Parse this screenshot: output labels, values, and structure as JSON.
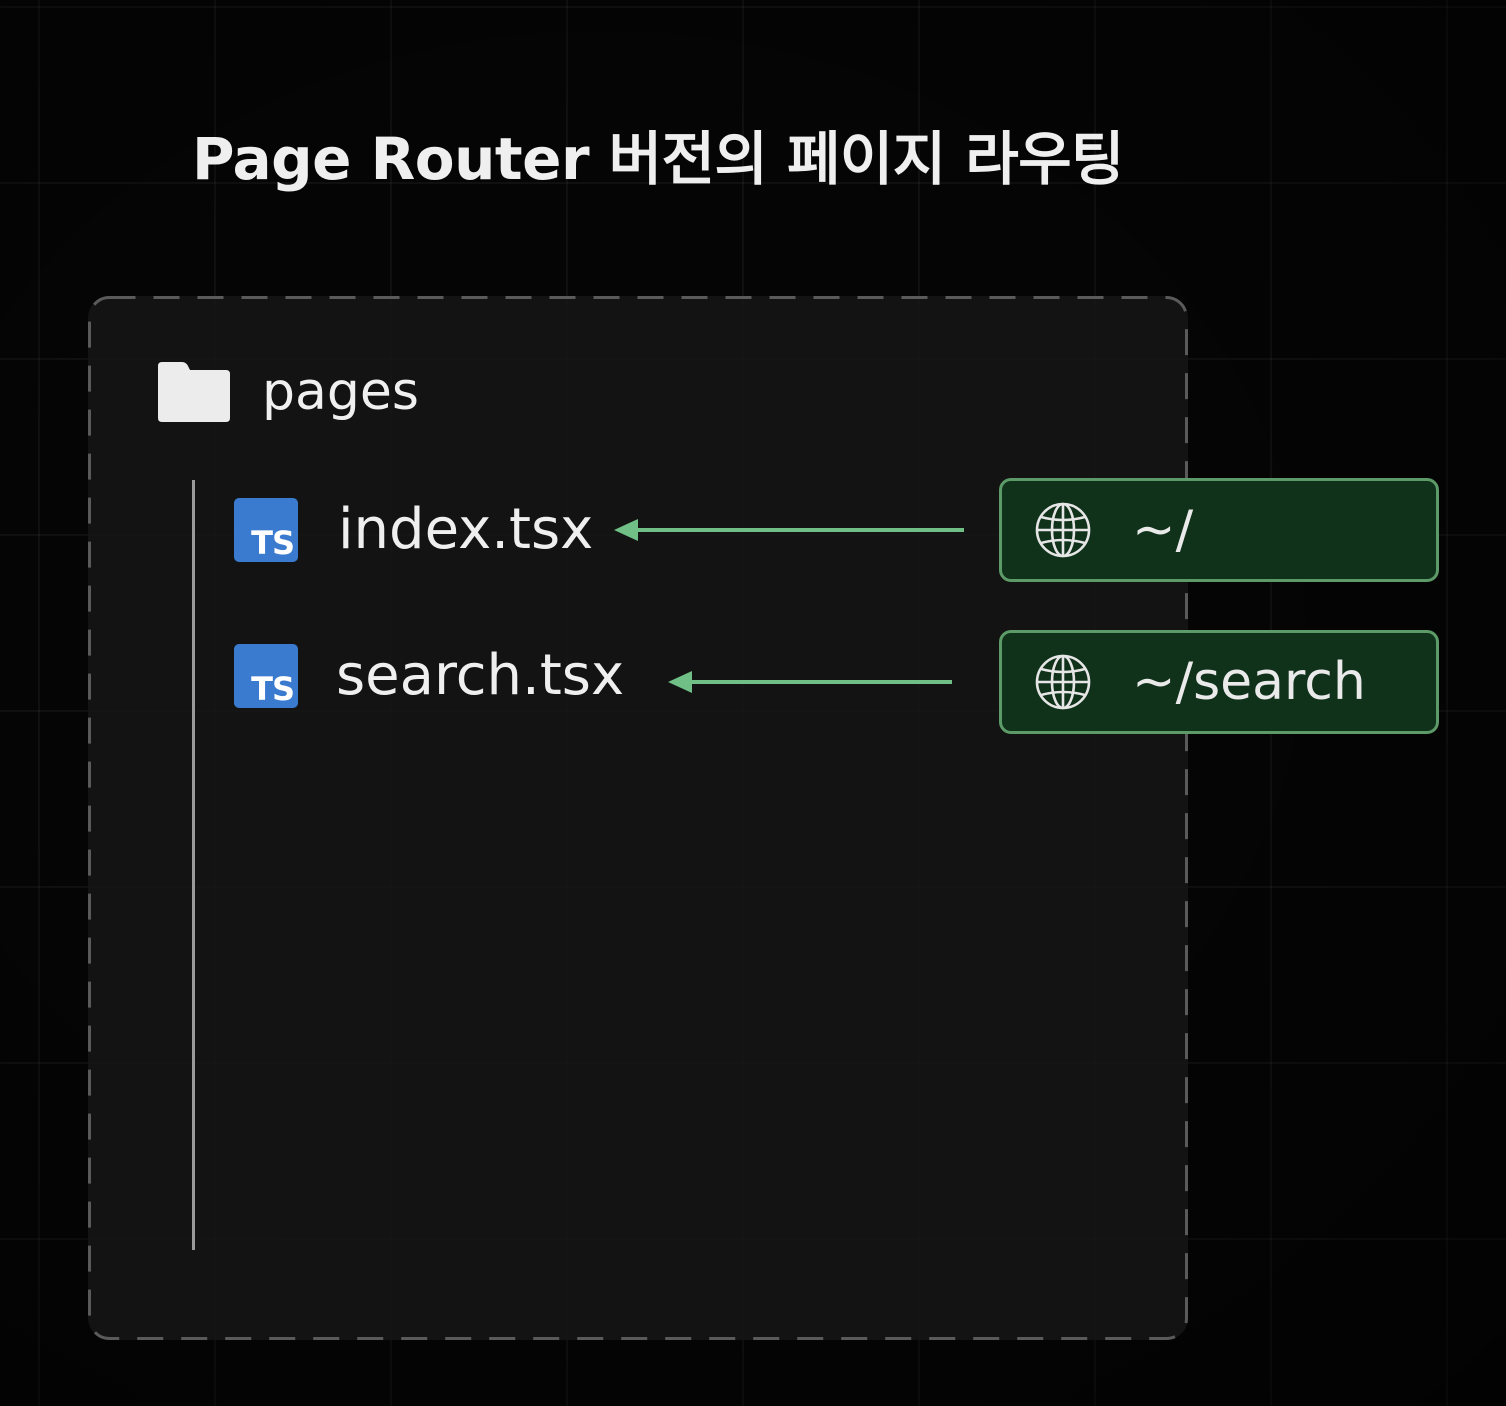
{
  "title": "Page Router 버전의 페이지 라우팅",
  "folder": {
    "icon": "folder-icon",
    "label": "pages"
  },
  "files": [
    {
      "icon": "typescript-file-icon",
      "badge": "TS",
      "label": "index.tsx"
    },
    {
      "icon": "typescript-file-icon",
      "badge": "TS",
      "label": "search.tsx"
    }
  ],
  "routes": [
    {
      "icon": "globe-icon",
      "label": "~/"
    },
    {
      "icon": "globe-icon",
      "label": "~/search"
    }
  ],
  "colors": {
    "background": "#050505",
    "panel": "#161616",
    "ts_blue": "#3a7bd0",
    "arrow_green": "#6fbf86",
    "route_border": "#5c9a68",
    "route_fill": "#10321b"
  }
}
